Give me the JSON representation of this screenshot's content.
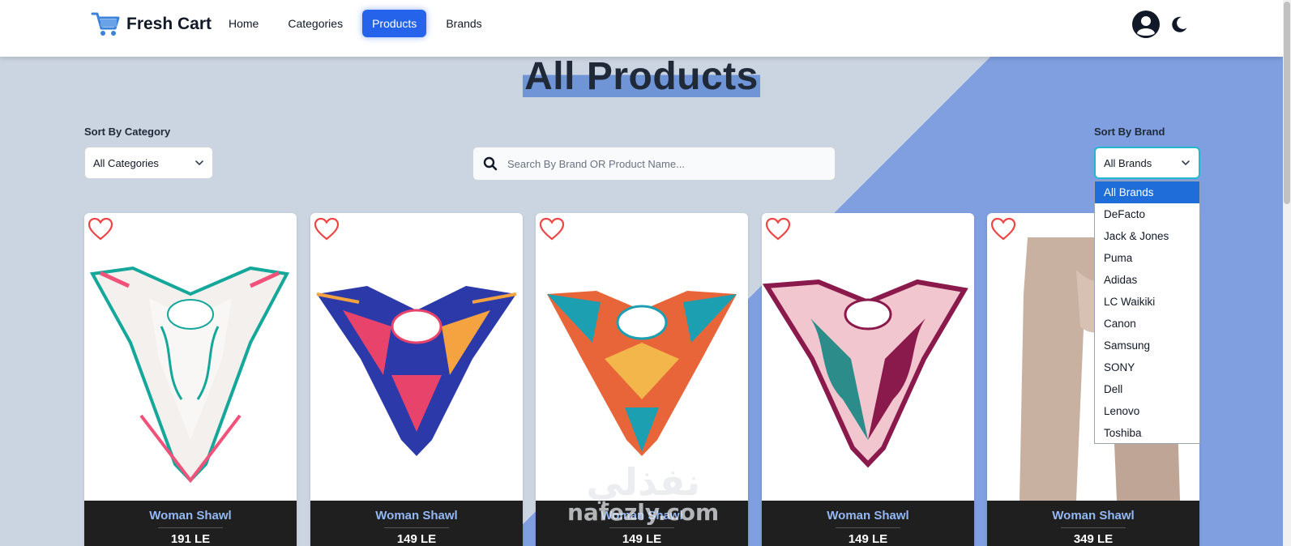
{
  "nav": {
    "brand": "Fresh Cart",
    "links": [
      {
        "label": "Home",
        "active": false
      },
      {
        "label": "Categories",
        "active": false
      },
      {
        "label": "Products",
        "active": true
      },
      {
        "label": "Brands",
        "active": false
      }
    ]
  },
  "page": {
    "title": "All Products"
  },
  "filters": {
    "category_label": "Sort By Category",
    "category_value": "All Categories",
    "search_placeholder": "Search By Brand OR Product Name...",
    "brand_label": "Sort By Brand",
    "brand_value": "All Brands",
    "brand_options": [
      "All Brands",
      "DeFacto",
      "Jack & Jones",
      "Puma",
      "Adidas",
      "LC Waikiki",
      "Canon",
      "Samsung",
      "SONY",
      "Dell",
      "Lenovo",
      "Toshiba"
    ],
    "brand_selected_index": 0
  },
  "products": [
    {
      "name": "Woman Shawl",
      "price": "191 LE",
      "colors": [
        "#f3f0ee",
        "#14a79a",
        "#f0527a"
      ]
    },
    {
      "name": "Woman Shawl",
      "price": "149 LE",
      "colors": [
        "#2b3aa8",
        "#e8436a",
        "#f4a340"
      ]
    },
    {
      "name": "Woman Shawl",
      "price": "149 LE",
      "colors": [
        "#e8653a",
        "#1b9fb1",
        "#f2b64a"
      ]
    },
    {
      "name": "Woman Shawl",
      "price": "149 LE",
      "colors": [
        "#8a1a4c",
        "#f2c6cf",
        "#2c8c8a"
      ]
    },
    {
      "name": "Woman Shawl",
      "price": "349 LE",
      "colors": [
        "#c9b1a2",
        "#bfa595",
        "#d6c1b3"
      ]
    }
  ],
  "watermark": {
    "arabic": "نفذلي",
    "latin": "nafezly.com"
  },
  "theme": {
    "accent": "#2563eb",
    "heart": "#ef4444",
    "card_footer": "#1f1f1f",
    "product_name": "#93b8f5"
  }
}
